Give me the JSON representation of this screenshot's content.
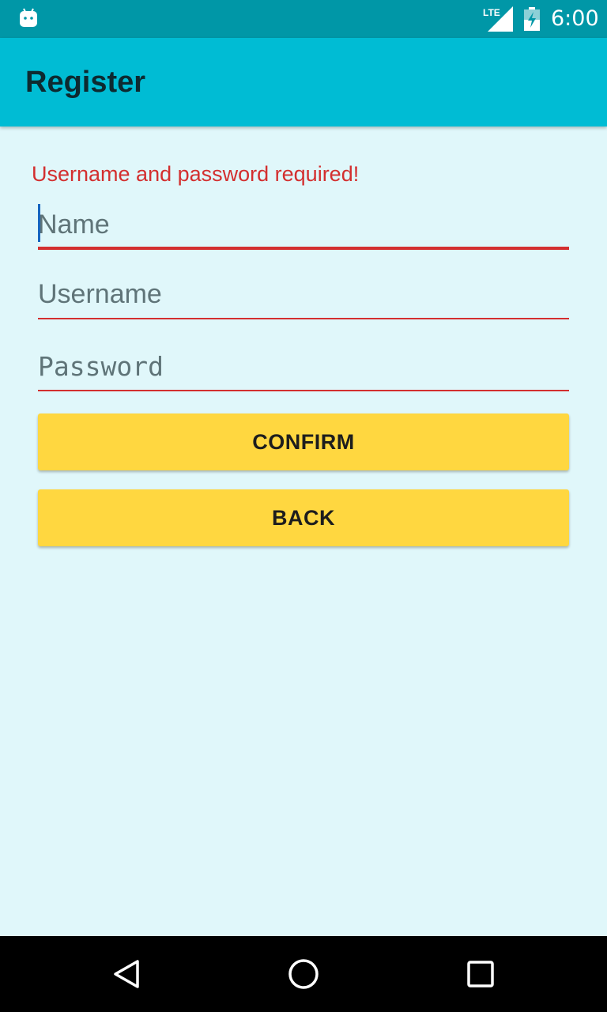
{
  "status_bar": {
    "time": "6:00",
    "network_label": "LTE",
    "icons": [
      "android-icon",
      "lte-signal-icon",
      "battery-icon"
    ]
  },
  "app_bar": {
    "title": "Register",
    "color": "#00BCD4"
  },
  "form": {
    "error_message": "Username and password required!",
    "fields": [
      {
        "placeholder": "Name",
        "value": ""
      },
      {
        "placeholder": "Username",
        "value": ""
      },
      {
        "placeholder": "Password",
        "value": ""
      }
    ],
    "confirm_label": "CONFIRM",
    "back_label": "BACK"
  },
  "nav_bar": {
    "icons": [
      "back-icon",
      "home-icon",
      "recents-icon"
    ]
  },
  "colors": {
    "status_bar": "#0097A7",
    "app_bar": "#00BCD4",
    "background": "#E0F7FA",
    "error": "#D32F2F",
    "button": "#FFD740"
  }
}
